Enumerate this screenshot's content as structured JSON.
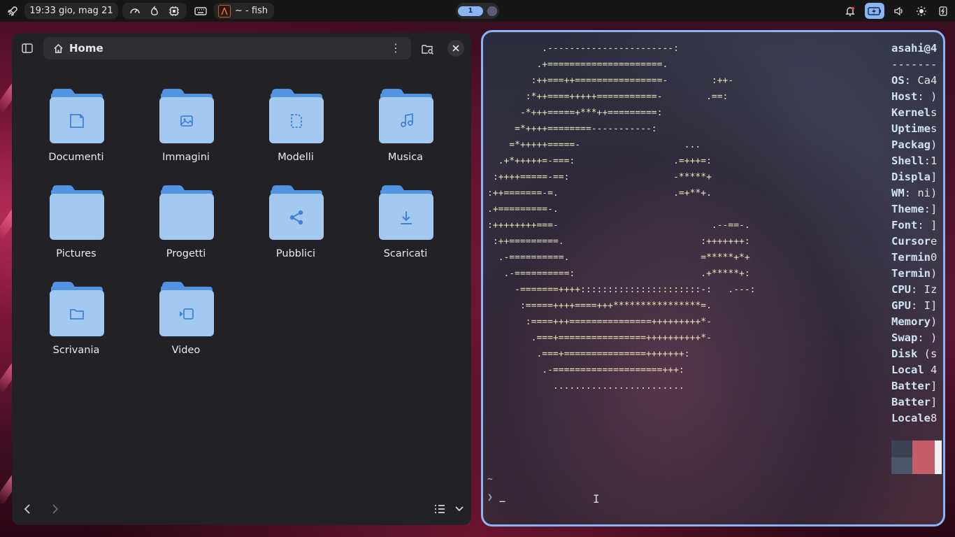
{
  "topbar": {
    "clock": "19:33 gio, mag 21",
    "window_title": "~ - fish",
    "workspace_active": "1"
  },
  "file_manager": {
    "path_label": "Home",
    "folders": [
      {
        "label": "Documenti",
        "icon": "document-icon"
      },
      {
        "label": "Immagini",
        "icon": "image-icon"
      },
      {
        "label": "Modelli",
        "icon": "template-icon"
      },
      {
        "label": "Musica",
        "icon": "music-icon"
      },
      {
        "label": "Pictures",
        "icon": ""
      },
      {
        "label": "Progetti",
        "icon": ""
      },
      {
        "label": "Pubblici",
        "icon": "share-icon"
      },
      {
        "label": "Scaricati",
        "icon": "download-icon"
      },
      {
        "label": "Scrivania",
        "icon": "desktop-icon"
      },
      {
        "label": "Video",
        "icon": "video-icon"
      }
    ]
  },
  "terminal": {
    "info": [
      {
        "key": "asahi@4",
        "val": ""
      },
      {
        "key": "",
        "val": "-------"
      },
      {
        "key": "OS",
        "val": ": Ca4"
      },
      {
        "key": "Host",
        "val": ": )"
      },
      {
        "key": "Kernel",
        "val": "s"
      },
      {
        "key": "Uptime",
        "val": "s"
      },
      {
        "key": "Packag",
        "val": ")"
      },
      {
        "key": "Shell",
        "val": ":1"
      },
      {
        "key": "Displa",
        "val": "]"
      },
      {
        "key": "WM",
        "val": ": ni)"
      },
      {
        "key": "Theme",
        "val": ":]"
      },
      {
        "key": "Font",
        "val": ": ]"
      },
      {
        "key": "Cursor",
        "val": "e"
      },
      {
        "key": "Termin",
        "val": "0"
      },
      {
        "key": "Termin",
        "val": ")"
      },
      {
        "key": "CPU",
        "val": ": Iz"
      },
      {
        "key": "GPU",
        "val": ": I]"
      },
      {
        "key": "Memory",
        "val": ")"
      },
      {
        "key": "Swap",
        "val": ": )"
      },
      {
        "key": "Disk",
        "val": " (s"
      },
      {
        "key": "Local",
        "val": " 4"
      },
      {
        "key": "Batter",
        "val": "]"
      },
      {
        "key": "Batter",
        "val": "]"
      },
      {
        "key": "Locale",
        "val": "8"
      }
    ],
    "palette_colors": [
      "#3c4254",
      "#c45c6a",
      "#f0f0f0",
      "#4c5468",
      "#c45c6a",
      "#f0f0f0"
    ],
    "cwd": "~",
    "prompt_symbol": "❯",
    "cursor": "_",
    "art_lines": [
      "          .-----------------------:",
      "         .+=====================.",
      "        :++===++================-        :++-",
      "       :*++====+++++===========-        .==:",
      "      -*+++=====+***++=========:",
      "     =*++++========-----------:",
      "    =*+++++=====-                   ...",
      "  .+*+++++=-===:                  .=+++=:",
      " :++++=====-==:                   -*****+",
      ":++=======-=.                     .=+**+.",
      ".+=========-.",
      ":++++++++===-                            .--==-.",
      " :++=========.                         :+++++++:",
      "  .-==========.                        =*****+*+",
      "   .-==========:                       .+*****+:",
      "     -=======++++::::::::::::::::::::::-:   .---:",
      "      :=====++++====+++****************=.",
      "       :====+++===============+++++++++*-",
      "        .===+================++++++++++*-",
      "         .===+===============+++++++:",
      "          .-====================+++:",
      "            ........................"
    ]
  }
}
